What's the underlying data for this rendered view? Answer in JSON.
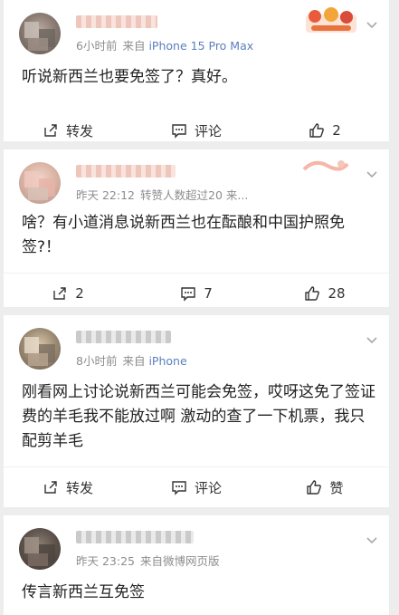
{
  "posts": [
    {
      "meta_time": "6小时前",
      "meta_src_prefix": "来自",
      "meta_device": "iPhone 15 Pro Max",
      "text": "听说新西兰也要免签了？真好。",
      "actions": {
        "repost": "转发",
        "comment": "评论",
        "like": "2"
      }
    },
    {
      "meta_time": "昨天 22:12",
      "meta_src_prefix": "转赞人数超过20 来...",
      "meta_device": "",
      "text": "啥？有小道消息说新西兰也在酝酿和中国护照免签?！",
      "actions": {
        "repost": "2",
        "comment": "7",
        "like": "28"
      }
    },
    {
      "meta_time": "8小时前",
      "meta_src_prefix": "来自",
      "meta_device": "iPhone",
      "text": "刚看网上讨论说新西兰可能会免签，哎呀这免了签证费的羊毛我不能放过啊 激动的查了一下机票，我只配剪羊毛",
      "actions": {
        "repost": "转发",
        "comment": "评论",
        "like": "赞"
      }
    },
    {
      "meta_time": "昨天 23:25",
      "meta_src_prefix": "来自微博网页版",
      "meta_device": "",
      "text": "传言新西兰互免签"
    }
  ],
  "icons": {
    "repost": "repost-icon",
    "comment": "comment-icon",
    "like": "like-icon",
    "more": "chevron-down-icon"
  },
  "colors": {
    "device_link": "#5b7fbf",
    "meta": "#8d8d8d",
    "background": "#ededed"
  }
}
